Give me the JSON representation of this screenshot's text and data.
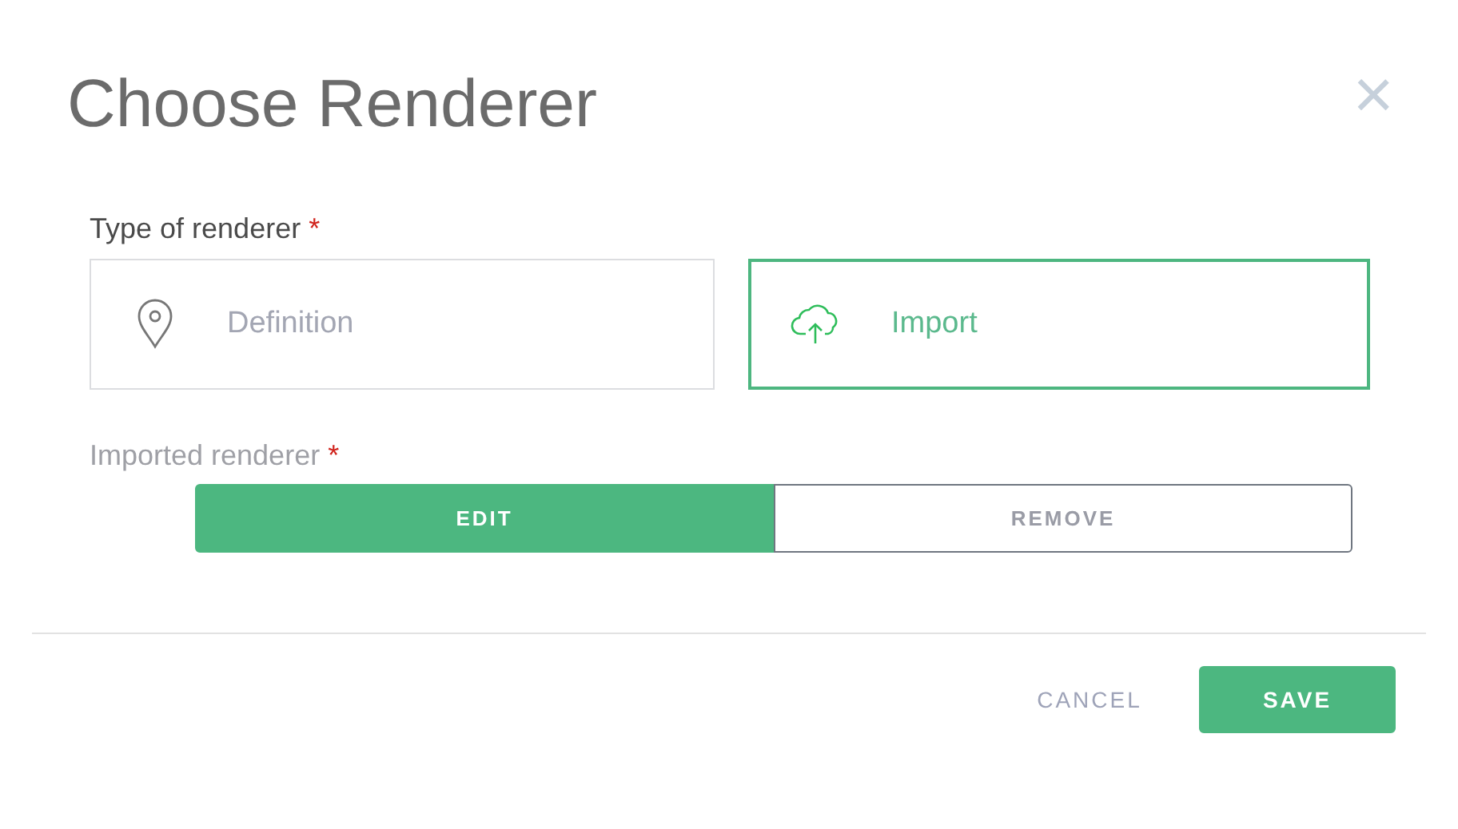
{
  "dialog": {
    "title": "Choose Renderer",
    "close": "×"
  },
  "type_field": {
    "label": "Type of renderer",
    "required_mark": "*",
    "disabled": false,
    "options": [
      {
        "label": "Definition",
        "kind": "pin",
        "selected": false
      },
      {
        "label": "Import",
        "kind": "upload",
        "selected": true
      }
    ]
  },
  "imported_field": {
    "label": "Imported renderer",
    "required_mark": "*",
    "disabled": true,
    "buttons": [
      {
        "label": "EDIT",
        "kind": "primary"
      },
      {
        "label": "REMOVE",
        "kind": "outline"
      }
    ]
  },
  "footer": {
    "buttons": [
      {
        "label": "CANCEL",
        "kind": "text"
      },
      {
        "label": "SAVE",
        "kind": "primary"
      }
    ]
  }
}
